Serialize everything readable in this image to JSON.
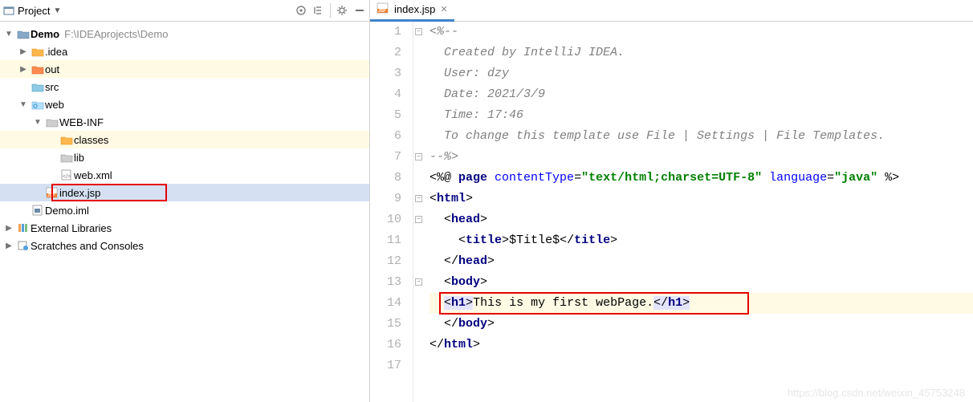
{
  "project": {
    "label": "Project"
  },
  "tree": {
    "root": {
      "name": "Demo",
      "path": "F:\\IDEAprojects\\Demo"
    },
    "idea": ".idea",
    "out": "out",
    "src": "src",
    "web": "web",
    "webinf": "WEB-INF",
    "classes": "classes",
    "lib": "lib",
    "webxml": "web.xml",
    "indexjsp": "index.jsp",
    "demoiml": "Demo.iml",
    "extlib": "External Libraries",
    "scratch": "Scratches and Consoles"
  },
  "tab": {
    "label": "index.jsp"
  },
  "code": {
    "l1": "<%--",
    "l2": "  Created by IntelliJ IDEA.",
    "l3": "  User: dzy",
    "l4": "  Date: 2021/3/9",
    "l5": "  Time: 17:46",
    "l6": "  To change this template use File | Settings | File Templates.",
    "l7": "--%>",
    "l8_a": "<%@ ",
    "l8_b": "page ",
    "l8_c": "contentType",
    "l8_d": "=",
    "l8_e": "\"text/html;charset=UTF-8\"",
    "l8_f": " language",
    "l8_g": "=",
    "l8_h": "\"java\"",
    "l8_i": " %>",
    "l9_a": "<",
    "l9_b": "html",
    "l9_c": ">",
    "l10_a": "<",
    "l10_b": "head",
    "l10_c": ">",
    "l11_a": "<",
    "l11_b": "title",
    "l11_c": ">",
    "l11_d": "$Title$",
    "l11_e": "</",
    "l11_f": "title",
    "l11_g": ">",
    "l12_a": "</",
    "l12_b": "head",
    "l12_c": ">",
    "l13_a": "<",
    "l13_b": "body",
    "l13_c": ">",
    "l14_a": "<",
    "l14_b": "h1",
    "l14_c": ">",
    "l14_d": "This is my first webPage.",
    "l14_e": "</",
    "l14_f": "h1",
    "l14_g": ">",
    "l15_a": "</",
    "l15_b": "body",
    "l15_c": ">",
    "l16_a": "</",
    "l16_b": "html",
    "l16_c": ">"
  },
  "lineNumbers": [
    "1",
    "2",
    "3",
    "4",
    "5",
    "6",
    "7",
    "8",
    "9",
    "10",
    "11",
    "12",
    "13",
    "14",
    "15",
    "16",
    "17"
  ],
  "watermark": "https://blog.csdn.net/weixin_45753248"
}
